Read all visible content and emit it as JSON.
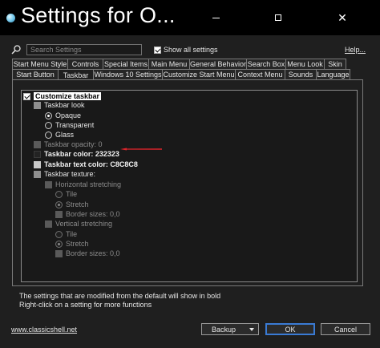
{
  "window": {
    "title": "Settings for O..."
  },
  "search": {
    "placeholder": "Search Settings"
  },
  "show_all": {
    "label": "Show all settings",
    "checked": true
  },
  "help": {
    "label": "Help..."
  },
  "tabs_row1": [
    "Start Menu Style",
    "Controls",
    "Special Items",
    "Main Menu",
    "General Behavior",
    "Search Box",
    "Menu Look",
    "Skin"
  ],
  "tabs_row2": [
    "Start Button",
    "Taskbar",
    "Windows 10 Settings",
    "Customize Start Menu",
    "Context Menu",
    "Sounds",
    "Language"
  ],
  "active_tab": "Taskbar",
  "tree": {
    "customize_taskbar": "Customize taskbar",
    "taskbar_look": "Taskbar look",
    "opaque": "Opaque",
    "transparent": "Transparent",
    "glass": "Glass",
    "opacity": "Taskbar opacity: 0",
    "color": "Taskbar color: 232323",
    "text_color": "Taskbar text color: C8C8C8",
    "texture": "Taskbar texture:",
    "horizontal_stretching": "Horizontal stretching",
    "h_tile": "Tile",
    "h_stretch": "Stretch",
    "h_border": "Border sizes: 0,0",
    "vertical_stretching": "Vertical stretching",
    "v_tile": "Tile",
    "v_stretch": "Stretch",
    "v_border": "Border sizes: 0,0"
  },
  "footer": {
    "line1": "The settings that are modified from the default will show in bold",
    "line2": "Right-click on a setting for more functions",
    "website": "www.classicshell.net"
  },
  "buttons": {
    "backup": "Backup",
    "ok": "OK",
    "cancel": "Cancel"
  },
  "colors": {
    "taskbar_color": "#232323",
    "text_color": "#C8C8C8",
    "annotation_arrow": "#e0242b",
    "ok_border": "#3a7bd5"
  }
}
